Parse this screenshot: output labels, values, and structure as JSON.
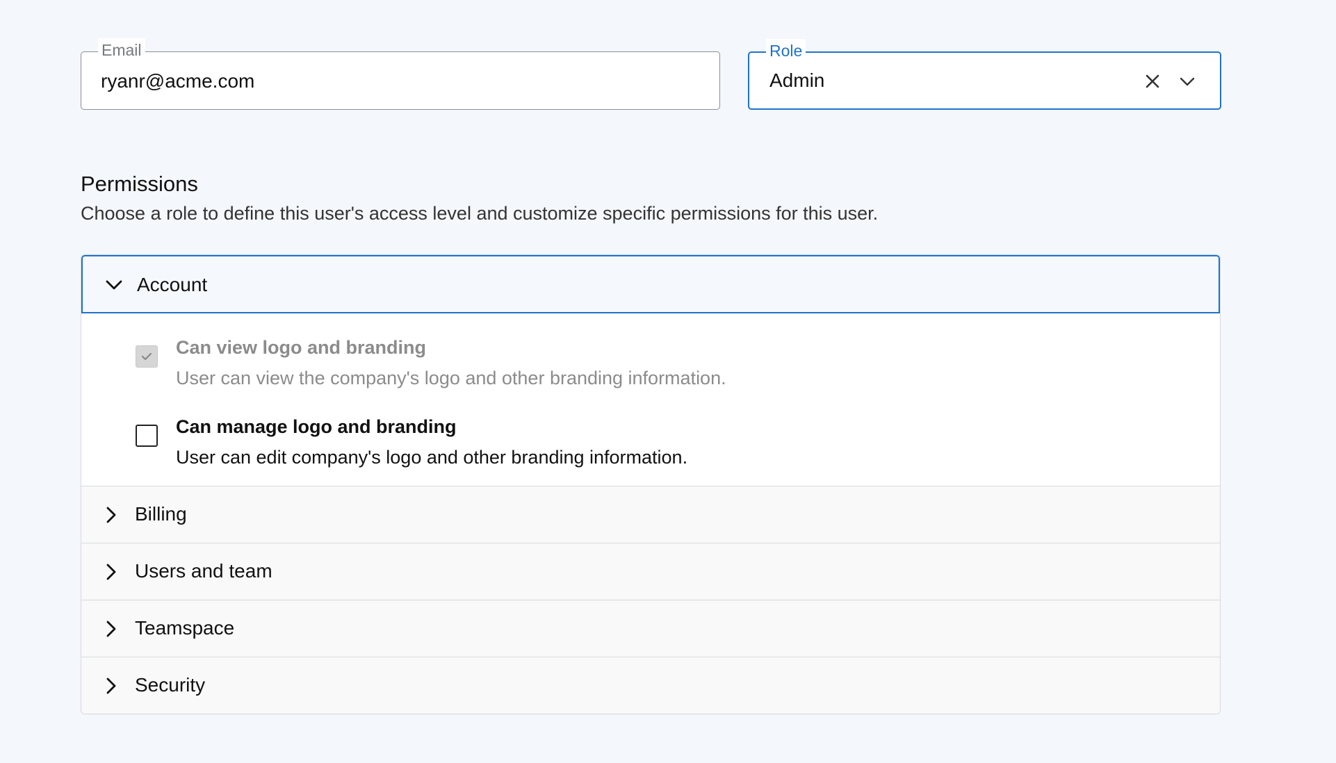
{
  "email_field": {
    "label": "Email",
    "value": "ryanr@acme.com"
  },
  "role_field": {
    "label": "Role",
    "value": "Admin"
  },
  "permissions": {
    "title": "Permissions",
    "description": "Choose a role to define this user's access level and customize specific permissions for this user."
  },
  "accordion": {
    "open_section": {
      "label": "Account",
      "items": [
        {
          "title": "Can view logo and branding",
          "description": "User can view the company's logo and other branding information.",
          "checked": true,
          "disabled": true
        },
        {
          "title": "Can manage logo and branding",
          "description": "User can edit company's logo and other branding information.",
          "checked": false,
          "disabled": false
        }
      ]
    },
    "collapsed_sections": [
      {
        "label": "Billing"
      },
      {
        "label": "Users and team"
      },
      {
        "label": "Teamspace"
      },
      {
        "label": "Security"
      }
    ]
  },
  "colors": {
    "accent": "#1f73c9",
    "background": "#f4f7fb",
    "disabled_text": "#8b8b8b"
  }
}
